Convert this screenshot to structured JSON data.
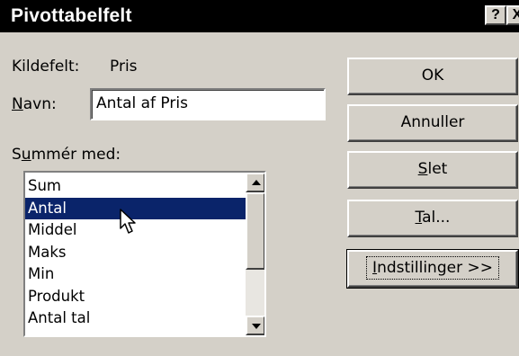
{
  "window": {
    "title": "Pivottabelfelt",
    "help_button": "?",
    "close_button": "X"
  },
  "source_field": {
    "label": "Kildefelt:",
    "value": "Pris"
  },
  "name_field": {
    "label_underlined": "N",
    "label_rest": "avn:",
    "value": "Antal af Pris"
  },
  "summarize": {
    "label_prefix": "S",
    "label_underlined": "u",
    "label_rest": "mmér med:",
    "selected": "Antal",
    "options": [
      "Sum",
      "Antal",
      "Middel",
      "Maks",
      "Min",
      "Produkt",
      "Antal tal"
    ]
  },
  "buttons": {
    "ok": {
      "label": "OK"
    },
    "cancel": {
      "label": "Annuller"
    },
    "delete": {
      "underlined": "S",
      "rest": "let"
    },
    "number": {
      "underlined": "T",
      "rest": "al..."
    },
    "options": {
      "underlined": "I",
      "rest": "ndstillinger >>"
    }
  },
  "colors": {
    "dialog_bg": "#d4d0c8",
    "titlebar_bg": "#000000",
    "selection_bg": "#0a246a"
  },
  "icons": {
    "scroll_up": "triangle-up-icon",
    "scroll_down": "triangle-down-icon",
    "pointer": "mouse-pointer-icon"
  }
}
